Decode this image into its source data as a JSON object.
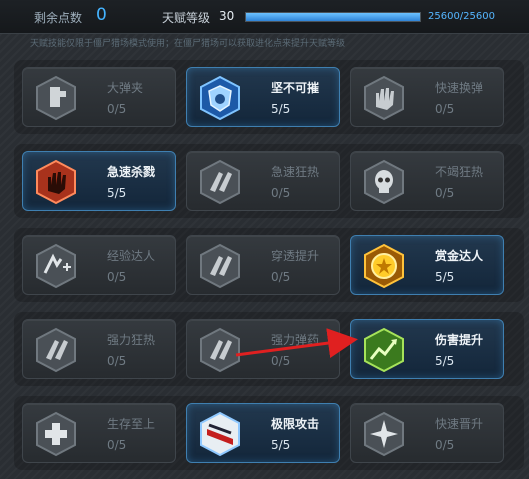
{
  "header": {
    "points_label": "剩余点数",
    "points_value": "0",
    "level_label": "天赋等级",
    "level_value": "30",
    "xp_text": "25600/25600",
    "xp_progress": 1.0,
    "hint": "天赋技能仅限于僵尸猎场模式使用；在僵尸猎场可以获取进化点来提升天赋等级"
  },
  "colors": {
    "accent": "#44b3ff",
    "active_border": "#3f7fb0",
    "arrow": "#e02020"
  },
  "talents": [
    {
      "name": "大弹夹",
      "count": "0/5",
      "active": false,
      "icon": "magazine-icon"
    },
    {
      "name": "坚不可摧",
      "count": "5/5",
      "active": true,
      "icon": "armor-shield-icon"
    },
    {
      "name": "快速换弹",
      "count": "0/5",
      "active": false,
      "icon": "hand-reload-icon"
    },
    {
      "name": "急速杀戮",
      "count": "5/5",
      "active": true,
      "icon": "bloody-hand-icon"
    },
    {
      "name": "急速狂热",
      "count": "0/5",
      "active": false,
      "icon": "frenzy-claw-icon"
    },
    {
      "name": "不竭狂热",
      "count": "0/5",
      "active": false,
      "icon": "skull-icon"
    },
    {
      "name": "经验达人",
      "count": "0/5",
      "active": false,
      "icon": "exp-plus-icon"
    },
    {
      "name": "穿透提升",
      "count": "0/5",
      "active": false,
      "icon": "pierce-claw-icon"
    },
    {
      "name": "赏金达人",
      "count": "5/5",
      "active": true,
      "icon": "gold-coin-icon"
    },
    {
      "name": "强力狂热",
      "count": "0/5",
      "active": false,
      "icon": "power-frenzy-icon"
    },
    {
      "name": "强力弹药",
      "count": "0/5",
      "active": false,
      "icon": "power-ammo-icon"
    },
    {
      "name": "伤害提升",
      "count": "5/5",
      "active": true,
      "icon": "damage-up-icon"
    },
    {
      "name": "生存至上",
      "count": "0/5",
      "active": false,
      "icon": "medical-cross-icon"
    },
    {
      "name": "极限攻击",
      "count": "5/5",
      "active": true,
      "icon": "extreme-attack-icon"
    },
    {
      "name": "快速晋升",
      "count": "0/5",
      "active": false,
      "icon": "star-burst-icon"
    }
  ]
}
